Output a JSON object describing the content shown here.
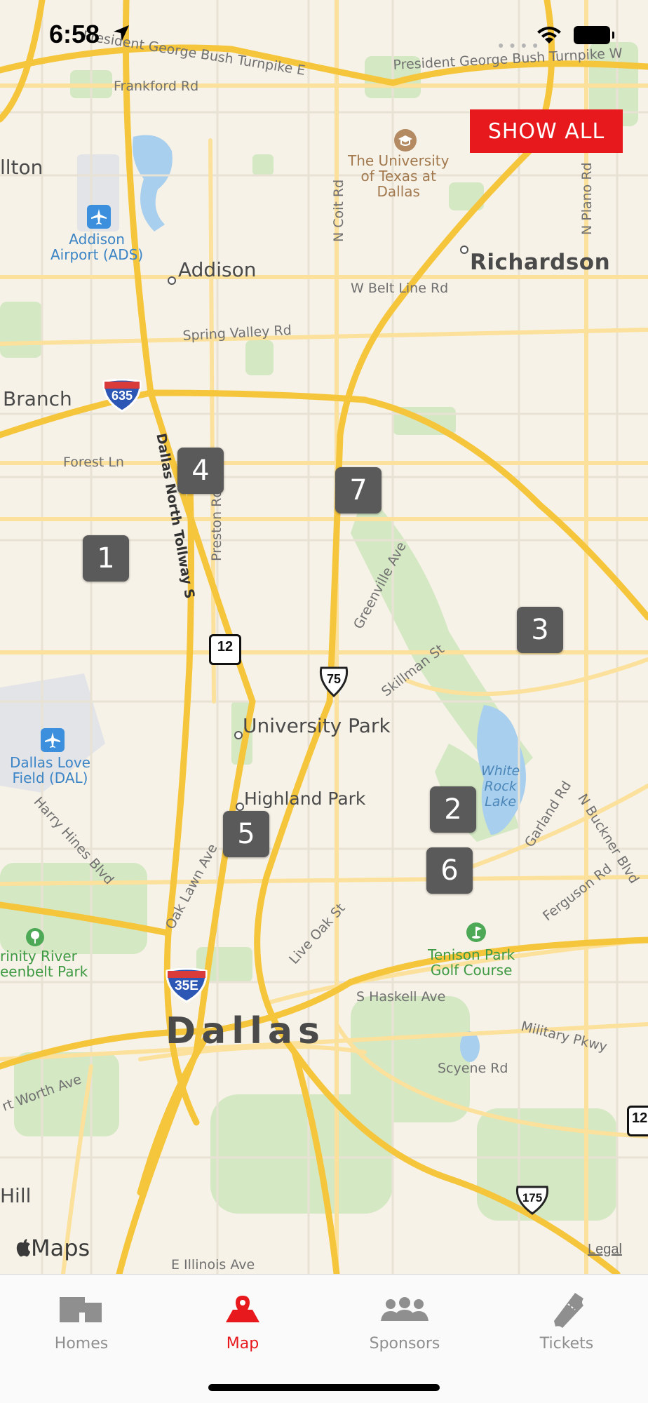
{
  "status_bar": {
    "time": "6:58"
  },
  "controls": {
    "show_all_label": "SHOW ALL"
  },
  "map": {
    "attribution": "Maps",
    "legal": "Legal",
    "places": {
      "addison": "Addison",
      "richardson": "Richardson",
      "university_park": "University Park",
      "highland_park": "Highland Park",
      "dallas": "Dallas",
      "branch": "Branch",
      "ilton": "llton",
      "hill": "Hill"
    },
    "roads": {
      "pgbt_1": "President George Bush Turnpike E",
      "pgbt_2": "President George Bush Turnpike W",
      "frankford": "Frankford Rd",
      "belt_line": "W Belt Line Rd",
      "spring_valley": "Spring Valley Rd",
      "n_coit": "N Coit Rd",
      "n_plano": "N Plano Rd",
      "forest": "Forest Ln",
      "tollway": "Dallas North Tollway S",
      "preston": "Preston Rd",
      "greenville": "Greenville Ave",
      "skillman": "Skillman St",
      "harry_hines": "Harry Hines Blvd",
      "oak_lawn": "Oak Lawn Ave",
      "live_oak": "Live Oak St",
      "garland": "Garland Rd",
      "n_buckner": "N Buckner Blvd",
      "ferguson": "Ferguson Rd",
      "military": "Military Pkwy",
      "s_haskell": "S Haskell Ave",
      "scyene": "Scyene Rd",
      "fort_worth": "rt Worth Ave",
      "e_illinois": "E Illinois Ave"
    },
    "pois": {
      "utd": "The University\nof Texas at\nDallas",
      "addison_airport": "Addison\nAirport (ADS)",
      "love_field": "Dallas Love\nField (DAL)",
      "trinity": "rinity River\neenbelt Park",
      "tenison": "Tenison Park\nGolf Course",
      "white_rock": "White\nRock\nLake"
    },
    "shields": {
      "i635": "635",
      "us75": "75",
      "sh12": "12",
      "i35e": "35E",
      "sh175": "175",
      "sh12b": "12"
    },
    "markers": [
      "1",
      "2",
      "3",
      "4",
      "5",
      "6",
      "7"
    ]
  },
  "tabs": [
    {
      "label": "Homes",
      "icon": "house-icon",
      "active": false
    },
    {
      "label": "Map",
      "icon": "map-pin-icon",
      "active": true
    },
    {
      "label": "Sponsors",
      "icon": "people-icon",
      "active": false
    },
    {
      "label": "Tickets",
      "icon": "ticket-icon",
      "active": false
    }
  ],
  "colors": {
    "accent": "#e8191d",
    "marker": "#5a5a5a",
    "highway": "#f5c53b",
    "park": "#cfe7c0",
    "water": "#a9cfee"
  }
}
